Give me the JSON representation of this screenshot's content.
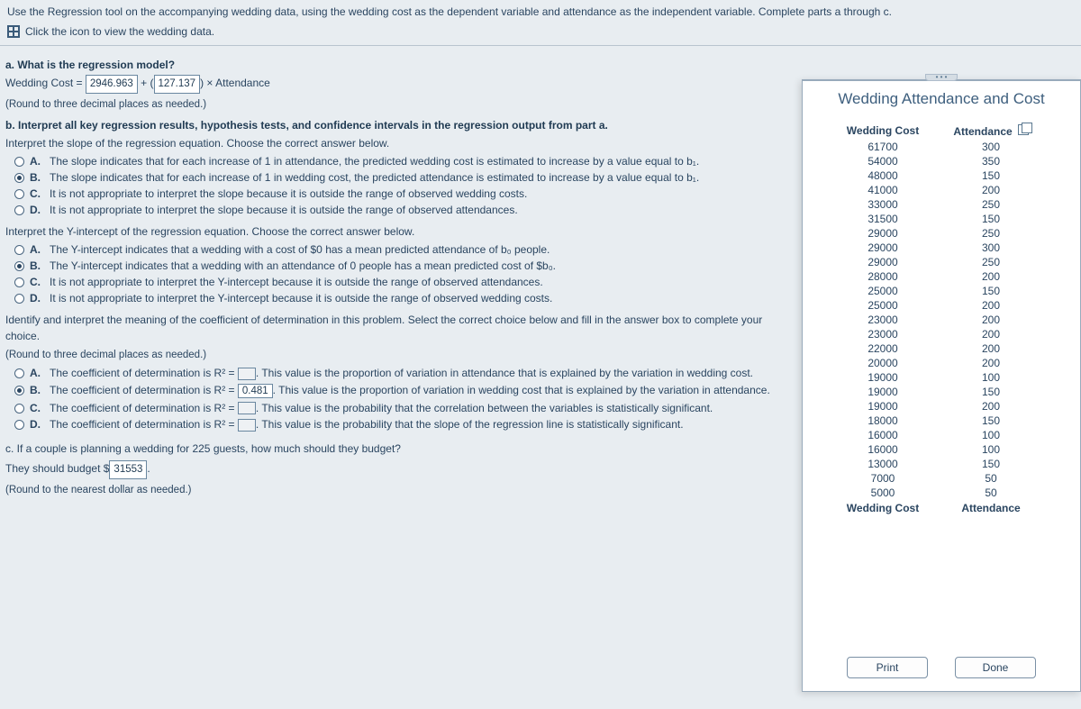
{
  "header": {
    "instruction": "Use the Regression tool on the accompanying wedding data, using the wedding cost as the dependent variable and attendance as the independent variable. Complete parts a through c.",
    "click_line": "Click the icon to view the wedding data."
  },
  "part_a": {
    "title": "a. What is the regression model?",
    "equation_lhs": "Wedding Cost =",
    "b0": "2946.963",
    "plus": " + ",
    "b1": "127.137",
    "times_x": " × Attendance",
    "round_note": "(Round to three decimal places as needed.)"
  },
  "part_b_intro": "b. Interpret all key regression results, hypothesis tests, and confidence intervals in the regression output from part a.",
  "slope_q": "Interpret the slope of the regression equation. Choose the correct answer below.",
  "slope_opts": {
    "a": "The slope indicates that for each increase of 1 in attendance, the predicted wedding cost is estimated to increase by a value equal to b₁.",
    "b": "The slope indicates that for each increase of 1 in wedding cost, the predicted attendance is estimated to increase by a value equal to b₁.",
    "c": "It is not appropriate to interpret the slope because it is outside the range of observed wedding costs.",
    "d": "It is not appropriate to interpret the slope because it is outside the range of observed attendances."
  },
  "yint_q": "Interpret the Y-intercept of the regression equation. Choose the correct answer below.",
  "yint_opts": {
    "a": "The Y-intercept indicates that a wedding with a cost of $0 has a mean predicted attendance of b₀ people.",
    "b": "The Y-intercept indicates that a wedding with an attendance of 0 people has a mean predicted cost of $b₀.",
    "c": "It is not appropriate to interpret the Y-intercept because it is outside the range of observed attendances.",
    "d": "It is not appropriate to interpret the Y-intercept because it is outside the range of observed wedding costs."
  },
  "coef_q": "Identify and interpret the meaning of the coefficient of determination in this problem. Select the correct choice below and fill in the answer box to complete your choice.",
  "coef_round": "(Round to three decimal places as needed.)",
  "coef_opts": {
    "a_pre": "The coefficient of determination is R² = ",
    "a_post": ". This value is the proportion of variation in attendance that is explained by the variation in wedding cost.",
    "b_pre": "The coefficient of determination is R² = ",
    "b_val": "0.481",
    "b_post": ". This value is the proportion of variation in wedding cost that is explained by the variation in attendance.",
    "c_pre": "The coefficient of determination is R² = ",
    "c_post": ". This value is the probability that the correlation between the variables is statistically significant.",
    "d_pre": "The coefficient of determination is R² = ",
    "d_post": ". This value is the probability that the slope of the regression line is statistically significant."
  },
  "part_c": {
    "q": "c. If a couple is planning a wedding for 225 guests, how much should they budget?",
    "ans_pre": "They should budget $",
    "ans_val": "31553",
    "ans_post": ".",
    "round": "(Round to the nearest dollar as needed.)"
  },
  "modal": {
    "title": "Wedding Attendance and Cost",
    "col1": "Wedding Cost",
    "col2": "Attendance",
    "footer1": "Wedding Cost",
    "footer2": "Attendance",
    "print": "Print",
    "done": "Done",
    "rows": [
      [
        "61700",
        "300"
      ],
      [
        "54000",
        "350"
      ],
      [
        "48000",
        "150"
      ],
      [
        "41000",
        "200"
      ],
      [
        "33000",
        "250"
      ],
      [
        "31500",
        "150"
      ],
      [
        "29000",
        "250"
      ],
      [
        "29000",
        "300"
      ],
      [
        "29000",
        "250"
      ],
      [
        "28000",
        "200"
      ],
      [
        "25000",
        "150"
      ],
      [
        "25000",
        "200"
      ],
      [
        "23000",
        "200"
      ],
      [
        "23000",
        "200"
      ],
      [
        "22000",
        "200"
      ],
      [
        "20000",
        "200"
      ],
      [
        "19000",
        "100"
      ],
      [
        "19000",
        "150"
      ],
      [
        "19000",
        "200"
      ],
      [
        "18000",
        "150"
      ],
      [
        "16000",
        "100"
      ],
      [
        "16000",
        "100"
      ],
      [
        "13000",
        "150"
      ],
      [
        "7000",
        "50"
      ],
      [
        "5000",
        "50"
      ]
    ]
  }
}
